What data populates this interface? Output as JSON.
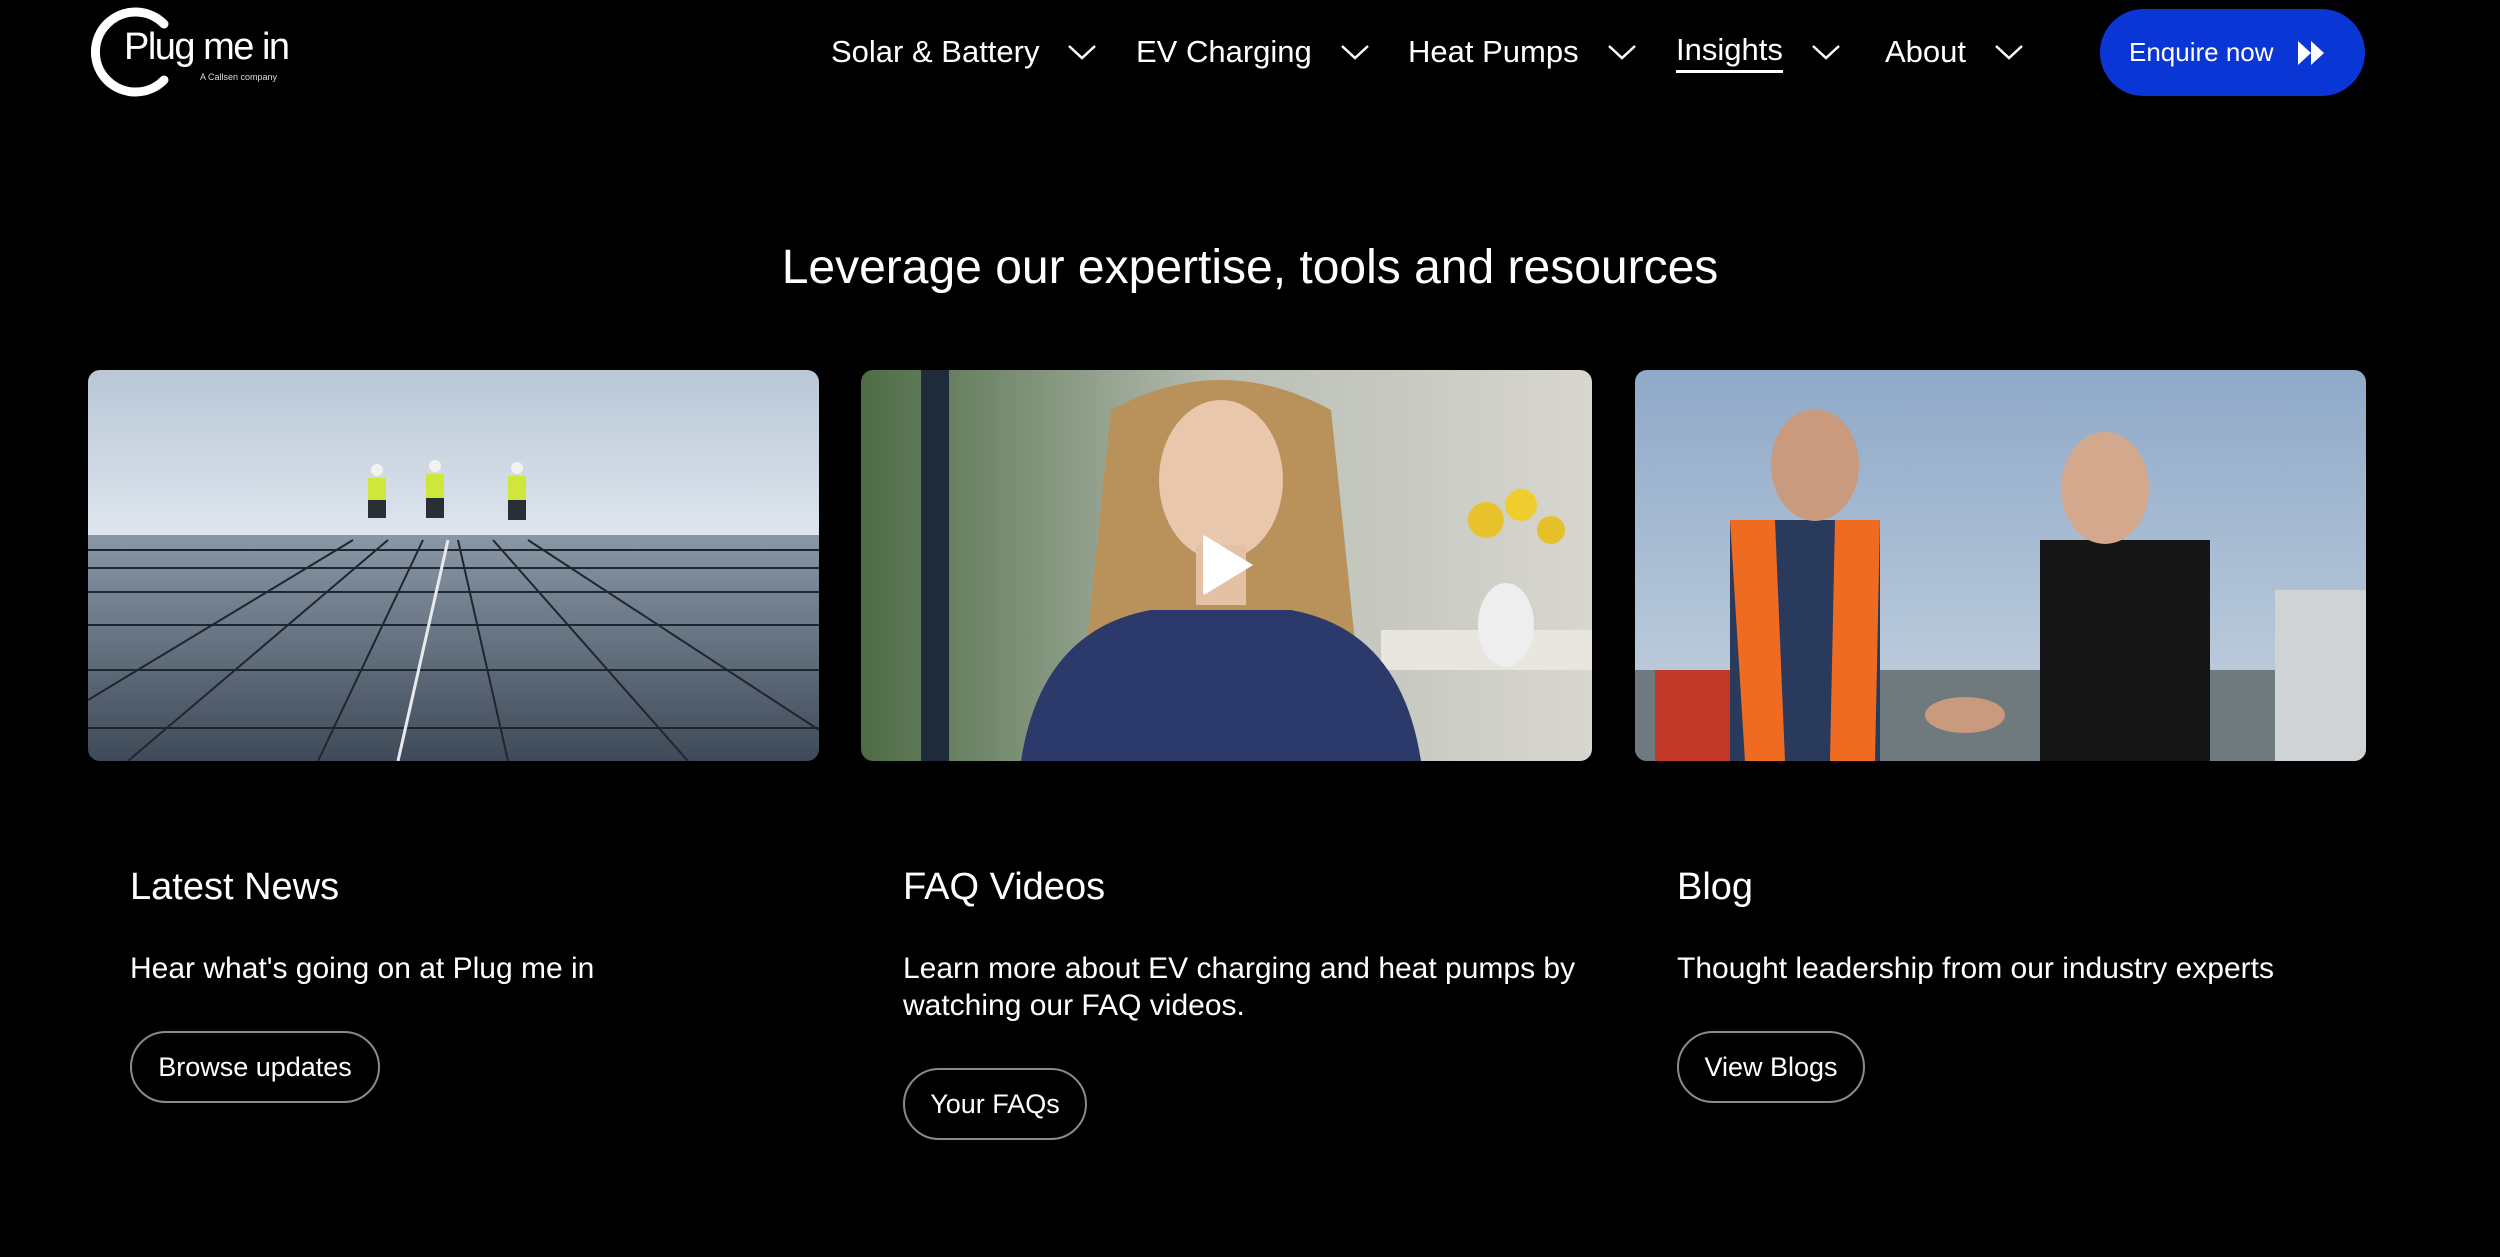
{
  "brand": {
    "name": "Plug me in",
    "tagline": "A Callsen company"
  },
  "nav": {
    "items": [
      {
        "label": "Solar & Battery"
      },
      {
        "label": "EV Charging"
      },
      {
        "label": "Heat Pumps"
      },
      {
        "label": "Insights",
        "active": true
      },
      {
        "label": "About"
      }
    ],
    "cta_label": "Enquire now"
  },
  "colors": {
    "accent": "#0a36d6",
    "background": "#000000",
    "text": "#ffffff"
  },
  "section": {
    "title": "Leverage our expertise, tools and resources",
    "cards": [
      {
        "title": "Latest News",
        "description": "Hear what's going on at Plug me in",
        "button": "Browse updates",
        "image_icon": "solar-roof-photo"
      },
      {
        "title": "FAQ Videos",
        "description": "Learn more about EV charging and heat pumps by watching our FAQ videos.",
        "button": "Your FAQs",
        "image_icon": "video-play-icon"
      },
      {
        "title": "Blog",
        "description": "Thought leadership from our industry experts",
        "button": "View Blogs",
        "image_icon": "handshake-photo"
      }
    ]
  }
}
